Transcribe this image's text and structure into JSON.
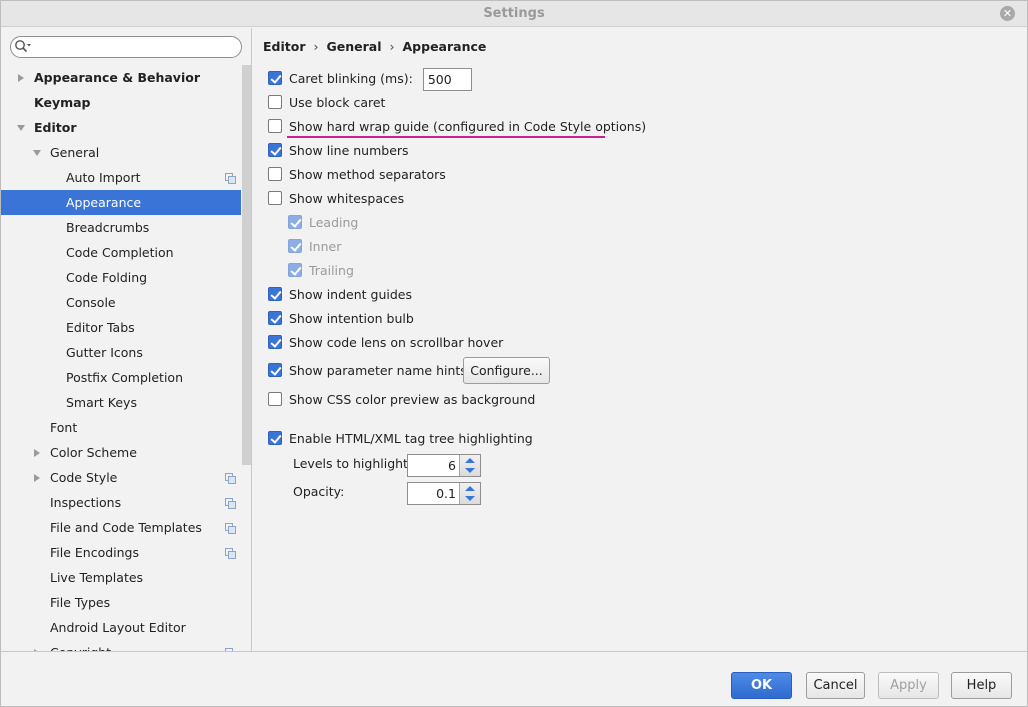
{
  "window": {
    "title": "Settings"
  },
  "search": {
    "placeholder": "",
    "value": ""
  },
  "tree": [
    {
      "label": "Appearance & Behavior",
      "indent": 0,
      "bold": true,
      "arrow": "right"
    },
    {
      "label": "Keymap",
      "indent": 0,
      "bold": true
    },
    {
      "label": "Editor",
      "indent": 0,
      "bold": true,
      "arrow": "down"
    },
    {
      "label": "General",
      "indent": 1,
      "arrow": "down"
    },
    {
      "label": "Auto Import",
      "indent": 2,
      "copy_icon": true
    },
    {
      "label": "Appearance",
      "indent": 2,
      "selected": true
    },
    {
      "label": "Breadcrumbs",
      "indent": 2
    },
    {
      "label": "Code Completion",
      "indent": 2
    },
    {
      "label": "Code Folding",
      "indent": 2
    },
    {
      "label": "Console",
      "indent": 2
    },
    {
      "label": "Editor Tabs",
      "indent": 2
    },
    {
      "label": "Gutter Icons",
      "indent": 2
    },
    {
      "label": "Postfix Completion",
      "indent": 2
    },
    {
      "label": "Smart Keys",
      "indent": 2
    },
    {
      "label": "Font",
      "indent": 1
    },
    {
      "label": "Color Scheme",
      "indent": 1,
      "arrow": "right"
    },
    {
      "label": "Code Style",
      "indent": 1,
      "arrow": "right",
      "copy_icon": true
    },
    {
      "label": "Inspections",
      "indent": 1,
      "copy_icon": true
    },
    {
      "label": "File and Code Templates",
      "indent": 1,
      "copy_icon": true
    },
    {
      "label": "File Encodings",
      "indent": 1,
      "copy_icon": true
    },
    {
      "label": "Live Templates",
      "indent": 1
    },
    {
      "label": "File Types",
      "indent": 1
    },
    {
      "label": "Android Layout Editor",
      "indent": 1
    },
    {
      "label": "Copyright",
      "indent": 1,
      "arrow": "right",
      "copy_icon": true
    }
  ],
  "breadcrumb": {
    "items": [
      "Editor",
      "General",
      "Appearance"
    ],
    "separator": "›"
  },
  "options": {
    "caret_blinking": {
      "label": "Caret blinking (ms):",
      "checked": true,
      "value": "500"
    },
    "block_caret": {
      "label": "Use block caret",
      "checked": false
    },
    "hard_wrap": {
      "label": "Show hard wrap guide (configured in Code Style options)",
      "checked": false
    },
    "line_numbers": {
      "label": "Show line numbers",
      "checked": true
    },
    "method_separators": {
      "label": "Show method separators",
      "checked": false
    },
    "whitespaces": {
      "label": "Show whitespaces",
      "checked": false
    },
    "leading": {
      "label": "Leading",
      "checked": true,
      "disabled": true
    },
    "inner": {
      "label": "Inner",
      "checked": true,
      "disabled": true
    },
    "trailing": {
      "label": "Trailing",
      "checked": true,
      "disabled": true
    },
    "indent_guides": {
      "label": "Show indent guides",
      "checked": true
    },
    "intention_bulb": {
      "label": "Show intention bulb",
      "checked": true
    },
    "code_lens": {
      "label": "Show code lens on scrollbar hover",
      "checked": true
    },
    "param_hints": {
      "label": "Show parameter name hints",
      "checked": true,
      "button": "Configure..."
    },
    "css_color": {
      "label": "Show CSS color preview as background",
      "checked": false
    },
    "tag_tree": {
      "label": "Enable HTML/XML tag tree highlighting",
      "checked": true
    }
  },
  "levels": {
    "label": "Levels to highlight:",
    "value": "6"
  },
  "opacity": {
    "label": "Opacity:",
    "value": "0.1"
  },
  "footer": {
    "ok": "OK",
    "cancel": "Cancel",
    "apply": "Apply",
    "help": "Help"
  },
  "colors": {
    "accent": "#3a74d6",
    "underline": "#c8248e"
  }
}
